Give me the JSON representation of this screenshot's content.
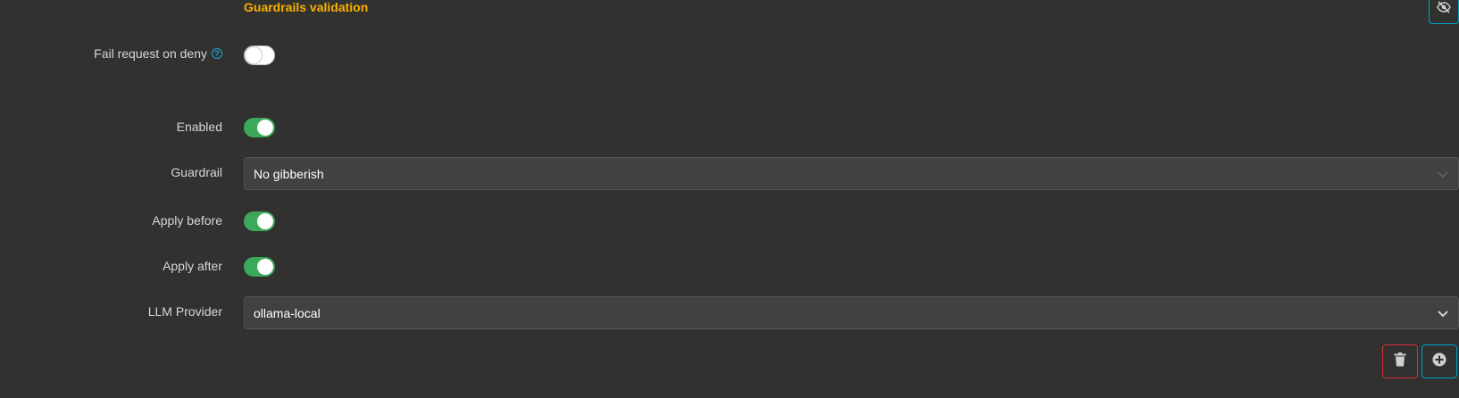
{
  "section": {
    "title": "Guardrails validation"
  },
  "fields": {
    "fail_request_on_deny": {
      "label": "Fail request on deny",
      "help_icon": "?",
      "enabled": false
    },
    "enabled": {
      "label": "Enabled",
      "enabled": true
    },
    "guardrail": {
      "label": "Guardrail",
      "value": "No gibberish",
      "options_icon": "chevron-down-icon"
    },
    "apply_before": {
      "label": "Apply before",
      "enabled": true
    },
    "apply_after": {
      "label": "Apply after",
      "enabled": true
    },
    "llm_provider": {
      "label": "LLM Provider",
      "value": "ollama-local",
      "options_icon": "chevron-down-icon"
    }
  },
  "actions": {
    "toggle_visibility_icon": "eye-slash-icon",
    "delete_icon": "trash-icon",
    "add_icon": "plus-circle-icon"
  },
  "colors": {
    "background": "#313130",
    "title": "#f9b000",
    "toggle_on": "#3ba85a",
    "accent": "#00a0c8",
    "danger": "#d9303b"
  }
}
